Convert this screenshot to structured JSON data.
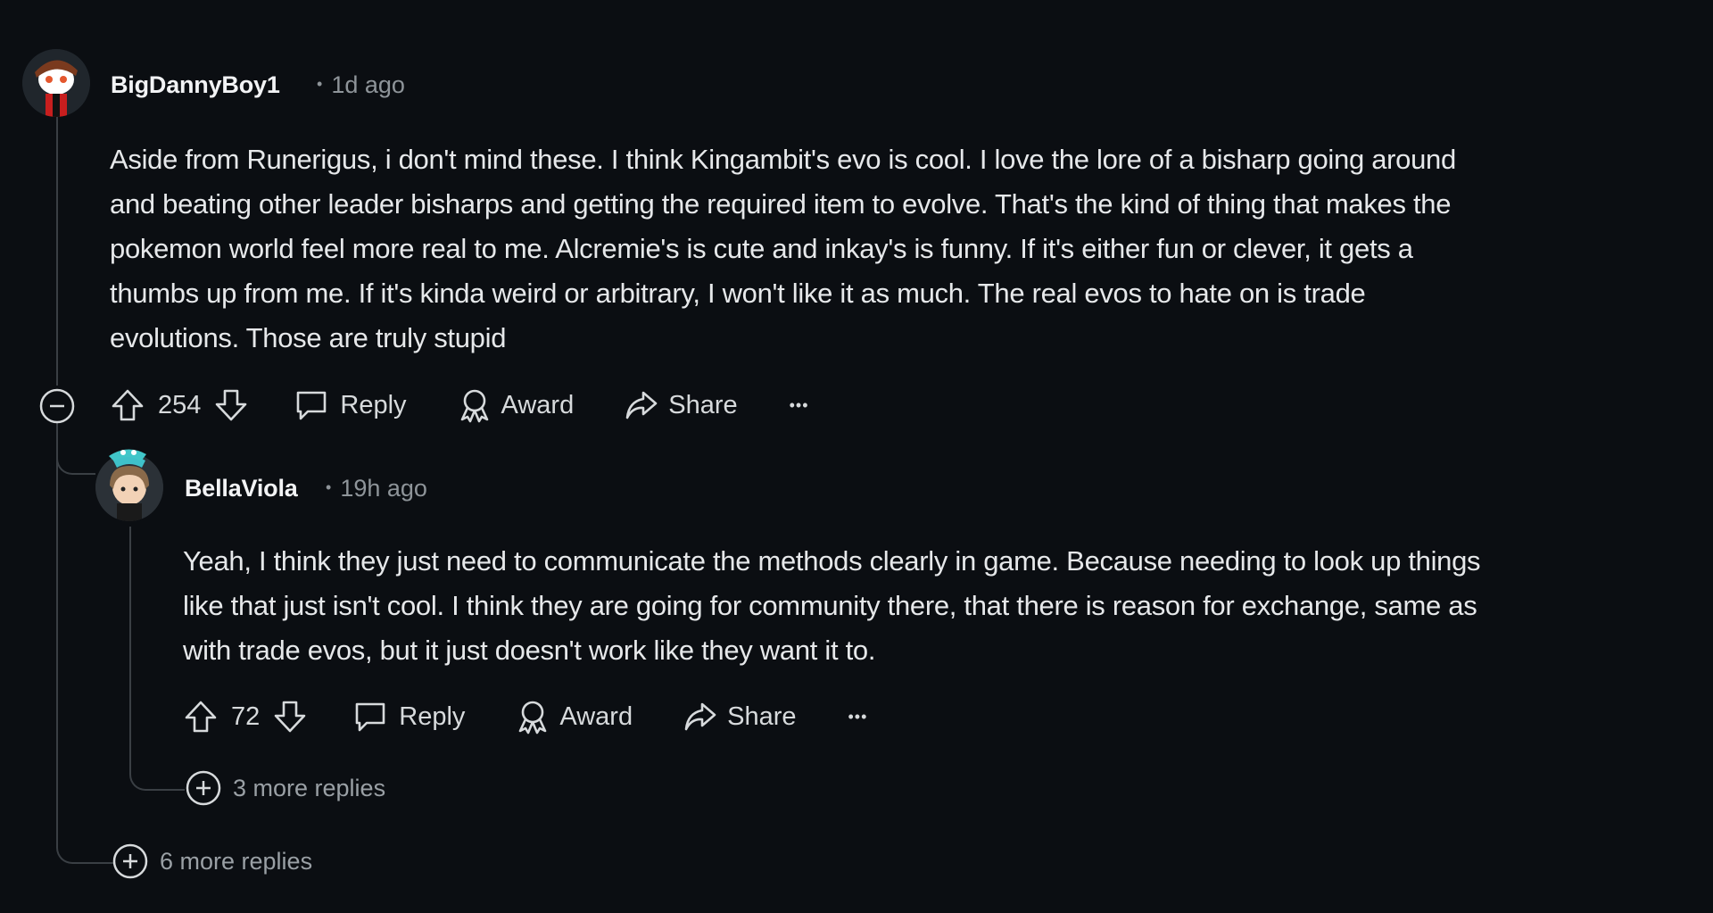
{
  "comments": [
    {
      "username": "BigDannyBoy1",
      "time": "1d ago",
      "lines": [
        "Aside from Runerigus, i don't mind these. I think Kingambit's evo is cool. I love the lore of a bisharp going around",
        "and beating other leader bisharps and getting the required item to evolve. That's the kind of thing that makes the",
        "pokemon world feel more real to me. Alcremie's is cute and inkay's is funny. If it's either fun or clever, it gets a",
        "thumbs up from me. If it's kinda weird or arbitrary, I won't like it as much. The real evos to hate on is trade",
        "evolutions. Those are truly stupid"
      ],
      "votes": "254",
      "reply_label": "Reply",
      "award_label": "Award",
      "share_label": "Share",
      "more_label": "•••",
      "more_replies": "6 more replies"
    },
    {
      "username": "BellaViola",
      "time": "19h ago",
      "lines": [
        "Yeah, I think they just need to communicate the methods clearly in game. Because needing to look up things",
        "like that just isn't cool. I think they are going for community there, that there is reason for exchange, same as",
        "with trade evos, but it just doesn't work like they want it to."
      ],
      "votes": "72",
      "reply_label": "Reply",
      "award_label": "Award",
      "share_label": "Share",
      "more_label": "•••",
      "more_replies": "3 more replies"
    }
  ],
  "icons": {
    "collapse": "collapse-icon",
    "upvote": "upvote-icon",
    "downvote": "downvote-icon",
    "reply": "reply-icon",
    "award": "award-icon",
    "share": "share-icon",
    "expand": "expand-icon"
  },
  "colors": {
    "background": "#0b0e12",
    "text": "#e6e8ea",
    "muted": "#8e9499",
    "thread_line": "#3a3f44"
  }
}
